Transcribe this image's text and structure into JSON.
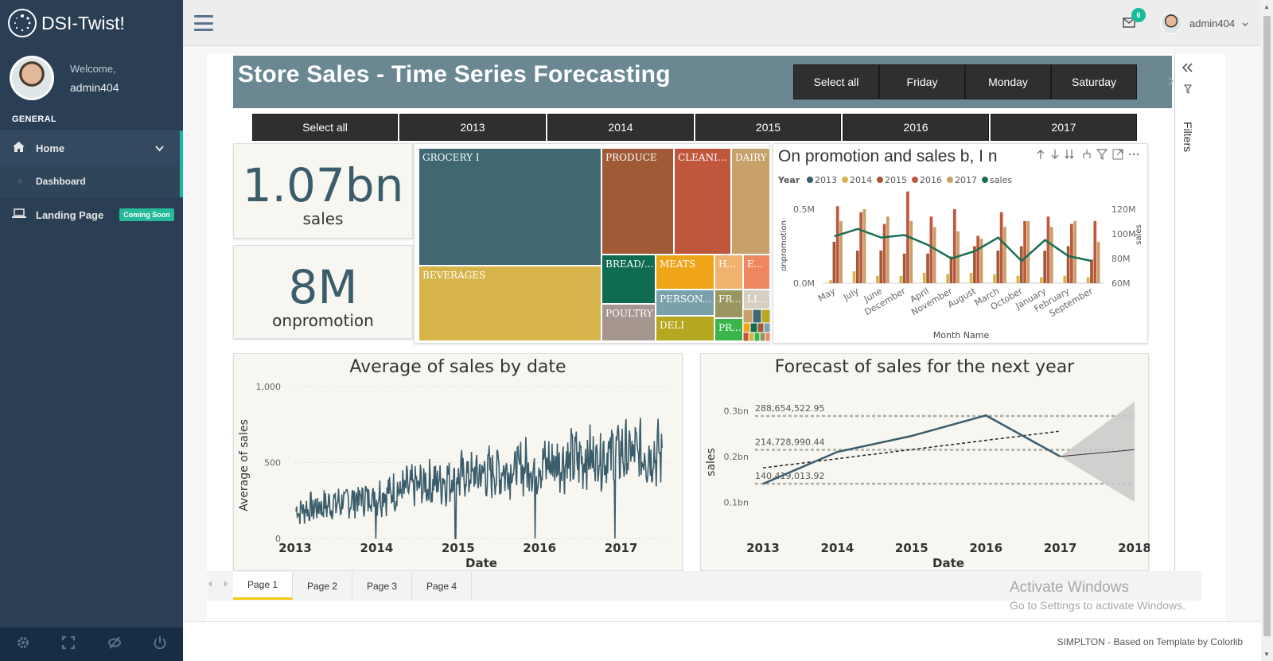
{
  "app": {
    "name": "DSI-Twist!"
  },
  "profile": {
    "welcome": "Welcome,",
    "username": "admin404"
  },
  "sidebar": {
    "section": "GENERAL",
    "home": "Home",
    "dashboard": "Dashboard",
    "landing": "Landing Page",
    "landing_badge": "Coming Soon"
  },
  "topbar": {
    "mail_count": "6",
    "user": "admin404"
  },
  "report": {
    "title": "Store Sales - Time Series Forecasting",
    "day_slicer": [
      "Select all",
      "Friday",
      "Monday",
      "Saturday"
    ],
    "year_slicer": [
      "Select all",
      "2013",
      "2014",
      "2015",
      "2016",
      "2017"
    ],
    "kpi_sales": {
      "value": "1.07bn",
      "label": "sales"
    },
    "kpi_promo": {
      "value": "8M",
      "label": "onpromotion"
    },
    "treemap": {
      "cells": [
        "GROCERY I",
        "PRODUCE",
        "CLEANI...",
        "DAIRY",
        "BEVERAGES",
        "BREAD/...",
        "MEATS",
        "H...",
        "E...",
        "PERSON...",
        "FR...",
        "LI...",
        "POULTRY",
        "DELI",
        "PR..."
      ]
    },
    "filters_label": "Filters",
    "pages": [
      "Page 1",
      "Page 2",
      "Page 3",
      "Page 4"
    ],
    "active_page": "Page 1"
  },
  "chart_data": [
    {
      "type": "bar",
      "title": "On promotion and sales b, I  n   ",
      "legend_title": "Year",
      "categories": [
        "May",
        "July",
        "June",
        "December",
        "April",
        "November",
        "August",
        "March",
        "October",
        "January",
        "February",
        "September"
      ],
      "series": [
        {
          "name": "2013",
          "color": "#3b5d6b",
          "values": [
            0,
            0,
            0,
            0,
            0,
            0,
            0,
            0,
            0,
            0,
            0,
            0
          ]
        },
        {
          "name": "2014",
          "color": "#d7b44a",
          "values": [
            0.02,
            0.08,
            0.05,
            0.05,
            0.07,
            0.06,
            0.07,
            0.06,
            0.05,
            0.04,
            0.05,
            0.04
          ]
        },
        {
          "name": "2015",
          "color": "#a05a36",
          "values": [
            0.28,
            0.22,
            0.22,
            0.2,
            0.2,
            0.18,
            0.25,
            0.22,
            0.25,
            0.22,
            0.25,
            0.16
          ]
        },
        {
          "name": "2016",
          "color": "#c0563c",
          "values": [
            0.52,
            0.48,
            0.4,
            0.62,
            0.45,
            0.5,
            0.32,
            0.48,
            0.42,
            0.45,
            0.4,
            0.42
          ]
        },
        {
          "name": "2017",
          "color": "#c8a06a",
          "values": [
            0.42,
            0.5,
            0.45,
            0.42,
            0.38,
            0.35,
            0.3,
            0.38,
            0.42,
            0.38,
            0.42,
            0.28
          ]
        }
      ],
      "line": {
        "name": "sales",
        "color": "#1b6e53",
        "values": [
          98,
          104,
          97,
          99,
          91,
          80,
          86,
          97,
          78,
          95,
          82,
          78
        ]
      },
      "xlabel": "Month Name",
      "ylabel": "onpromotion",
      "y2label": "sales",
      "y_ticks": [
        "0.0M",
        "0.5M"
      ],
      "y2_ticks": [
        "60M",
        "80M",
        "100M",
        "120M"
      ],
      "ylim": [
        0,
        0.5
      ],
      "y2lim": [
        60,
        120
      ]
    },
    {
      "type": "line",
      "title": "Average of sales by date",
      "xlabel": "Date",
      "ylabel": "Average of sales",
      "x_ticks": [
        "2013",
        "2014",
        "2015",
        "2016",
        "2017"
      ],
      "y_ticks": [
        "0",
        "500",
        "1,000"
      ],
      "ylim": [
        0,
        1000
      ],
      "series": [
        {
          "name": "Average of sales",
          "color": "#3b5d6b",
          "approx_level_by_year": [
            180,
            280,
            400,
            480,
            560
          ]
        }
      ]
    },
    {
      "type": "line",
      "title": "Forecast of sales for the next year",
      "xlabel": "Date",
      "ylabel": "sales",
      "x": [
        "2013",
        "2014",
        "2015",
        "2016",
        "2017",
        "2018"
      ],
      "y_ticks": [
        "0.1bn",
        "0.2bn",
        "0.3bn"
      ],
      "series": [
        {
          "name": "sales",
          "color": "#3b5d6b",
          "values": [
            0.14,
            0.21,
            0.245,
            0.29,
            0.2,
            null
          ]
        },
        {
          "name": "forecast",
          "color": "#333333",
          "values": [
            null,
            null,
            null,
            null,
            0.2,
            0.215
          ]
        }
      ],
      "reference_lines": [
        "288,654,522.95",
        "214,728,990.44",
        "140,419,013.92"
      ]
    }
  ],
  "watermark": {
    "line1": "Activate Windows",
    "line2": "Go to Settings to activate Windows."
  },
  "footer": {
    "credit": "SIMPLTON - Based on Template by Colorlib"
  }
}
